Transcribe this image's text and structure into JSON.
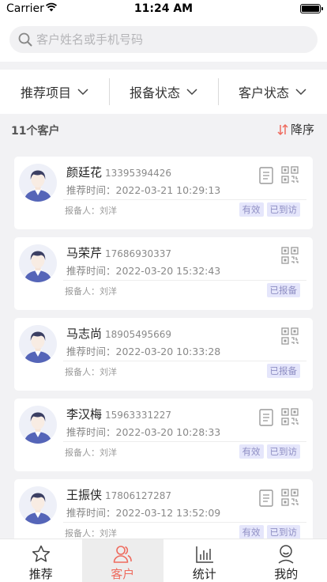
{
  "status_bar": {
    "carrier": "Carrier",
    "time": "11:24 AM"
  },
  "search": {
    "placeholder": "客户姓名或手机号码",
    "value": ""
  },
  "filters": [
    {
      "label": "推荐项目",
      "icon": "chevron-down-icon"
    },
    {
      "label": "报备状态",
      "icon": "chevron-down-icon"
    },
    {
      "label": "客户状态",
      "icon": "chevron-down-icon"
    }
  ],
  "summary": {
    "count_label": "11个客户",
    "sort_label": "降序",
    "sort_icon": "sort-arrows-icon"
  },
  "colors": {
    "accent": "#ee6b5e",
    "tag_bg": "#e5e6fb",
    "tag_text": "#8f8fc4",
    "avatar": "#5565b8"
  },
  "customers": [
    {
      "name": "颜廷花",
      "phone": "13395394426",
      "rec_time": "推荐时间：2022-03-21 10:29:13",
      "reporter": "报备人：刘洋",
      "has_doc": true,
      "tags": [
        "有效",
        "已到访"
      ]
    },
    {
      "name": "马荣芹",
      "phone": "17686930337",
      "rec_time": "推荐时间：2022-03-20 15:32:43",
      "reporter": "报备人：刘洋",
      "has_doc": false,
      "tags": [
        "已报备"
      ]
    },
    {
      "name": "马志尚",
      "phone": "18905495669",
      "rec_time": "推荐时间：2022-03-20 10:33:28",
      "reporter": "报备人：刘洋",
      "has_doc": false,
      "tags": [
        "已报备"
      ]
    },
    {
      "name": "李汉梅",
      "phone": "15963331227",
      "rec_time": "推荐时间：2022-03-20 10:28:33",
      "reporter": "报备人：刘洋",
      "has_doc": true,
      "tags": [
        "有效",
        "已到访"
      ]
    },
    {
      "name": "王振侠",
      "phone": "17806127287",
      "rec_time": "推荐时间：2022-03-12 13:52:09",
      "reporter": "报备人：刘洋",
      "has_doc": true,
      "tags": [
        "有效",
        "已到访"
      ]
    }
  ],
  "tabs": [
    {
      "label": "推荐",
      "icon": "star-icon",
      "active": false
    },
    {
      "label": "客户",
      "icon": "users-icon",
      "active": true
    },
    {
      "label": "统计",
      "icon": "bar-chart-icon",
      "active": false
    },
    {
      "label": "我的",
      "icon": "user-icon",
      "active": false
    }
  ]
}
